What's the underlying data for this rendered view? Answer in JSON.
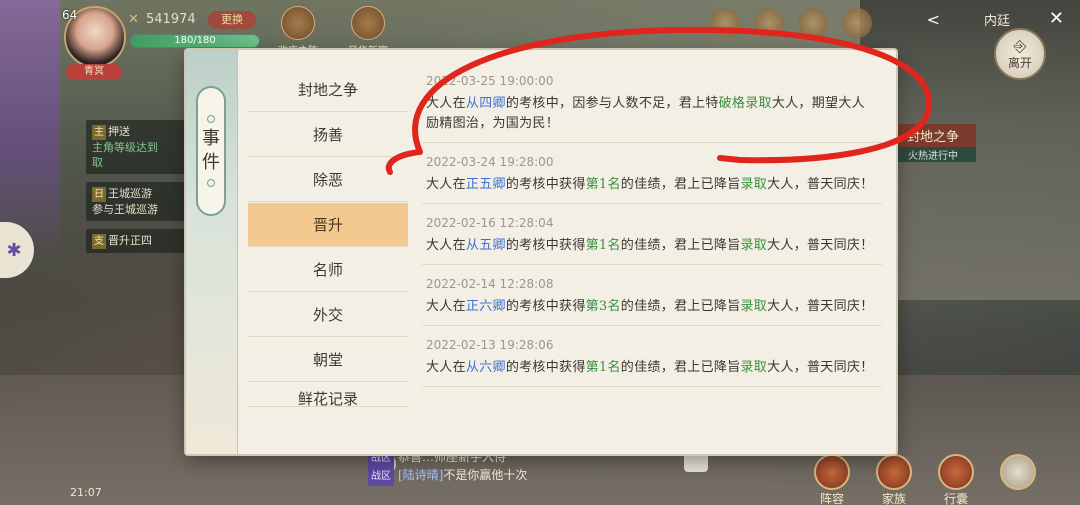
{
  "hud": {
    "level": "64",
    "player_name": "青冥",
    "power": "541974",
    "change_label": "更换",
    "stamina": "180/180",
    "stamina_fraction": 1.0
  },
  "top_icons": [
    "欢庆之阵",
    "风华新宴"
  ],
  "top_right": {
    "back_label": "<",
    "title": "内廷",
    "leave_label": "离开",
    "event_banner_title": "封地之争",
    "event_banner_status": "火热进行中"
  },
  "quests": [
    {
      "tag": "主",
      "title": "押送",
      "desc": "主角等级达到",
      "desc2": "取"
    },
    {
      "tag": "日",
      "title": "王城巡游",
      "desc": "参与王城巡游"
    },
    {
      "tag": "支",
      "title": "晋升正四",
      "desc": ""
    }
  ],
  "modal": {
    "spine_label": [
      "事",
      "件"
    ],
    "categories": [
      "封地之争",
      "扬善",
      "除恶",
      "晋升",
      "名师",
      "外交",
      "朝堂",
      "鲜花记录"
    ],
    "active_category": "晋升",
    "records": [
      {
        "timestamp": "2022-03-25 19:00:00",
        "parts": [
          "大人在",
          "从四卿",
          "的考核中，因参与人数不足，君上特",
          "破格录取",
          "大人，期望大人励精图治，为国为民！"
        ]
      },
      {
        "timestamp": "2022-03-24 19:28:00",
        "parts": [
          "大人在",
          "正五卿",
          "的考核中获得",
          "第1名",
          "的佳绩，君上已降旨",
          "录取",
          "大人，普天同庆！"
        ]
      },
      {
        "timestamp": "2022-02-16 12:28:04",
        "parts": [
          "大人在",
          "从五卿",
          "的考核中获得",
          "第1名",
          "的佳绩，君上已降旨",
          "录取",
          "大人，普天同庆！"
        ]
      },
      {
        "timestamp": "2022-02-14 12:28:08",
        "parts": [
          "大人在",
          "正六卿",
          "的考核中获得",
          "第3名",
          "的佳绩，君上已降旨",
          "录取",
          "大人，普天同庆！"
        ]
      },
      {
        "timestamp": "2022-02-13 19:28:06",
        "parts": [
          "大人在",
          "从六卿",
          "的考核中获得",
          "第1名",
          "的佳绩，君上已降旨",
          "录取",
          "大人，普天同庆！"
        ]
      }
    ]
  },
  "chat": [
    {
      "channel": "战区",
      "who": "",
      "text": "恭喜…师座新手入侍"
    },
    {
      "channel": "战区",
      "who": "[陆诗晴]",
      "text": "不是你赢他十次"
    }
  ],
  "clock": "21:07",
  "bottom_buttons": [
    "阵容",
    "家族",
    "行囊",
    ""
  ],
  "colors": {
    "highlight_blue": "#3f6fd2",
    "highlight_green": "#3b8f3e",
    "active_tab": "#f2c98f",
    "annotation_red": "#e0261c"
  }
}
